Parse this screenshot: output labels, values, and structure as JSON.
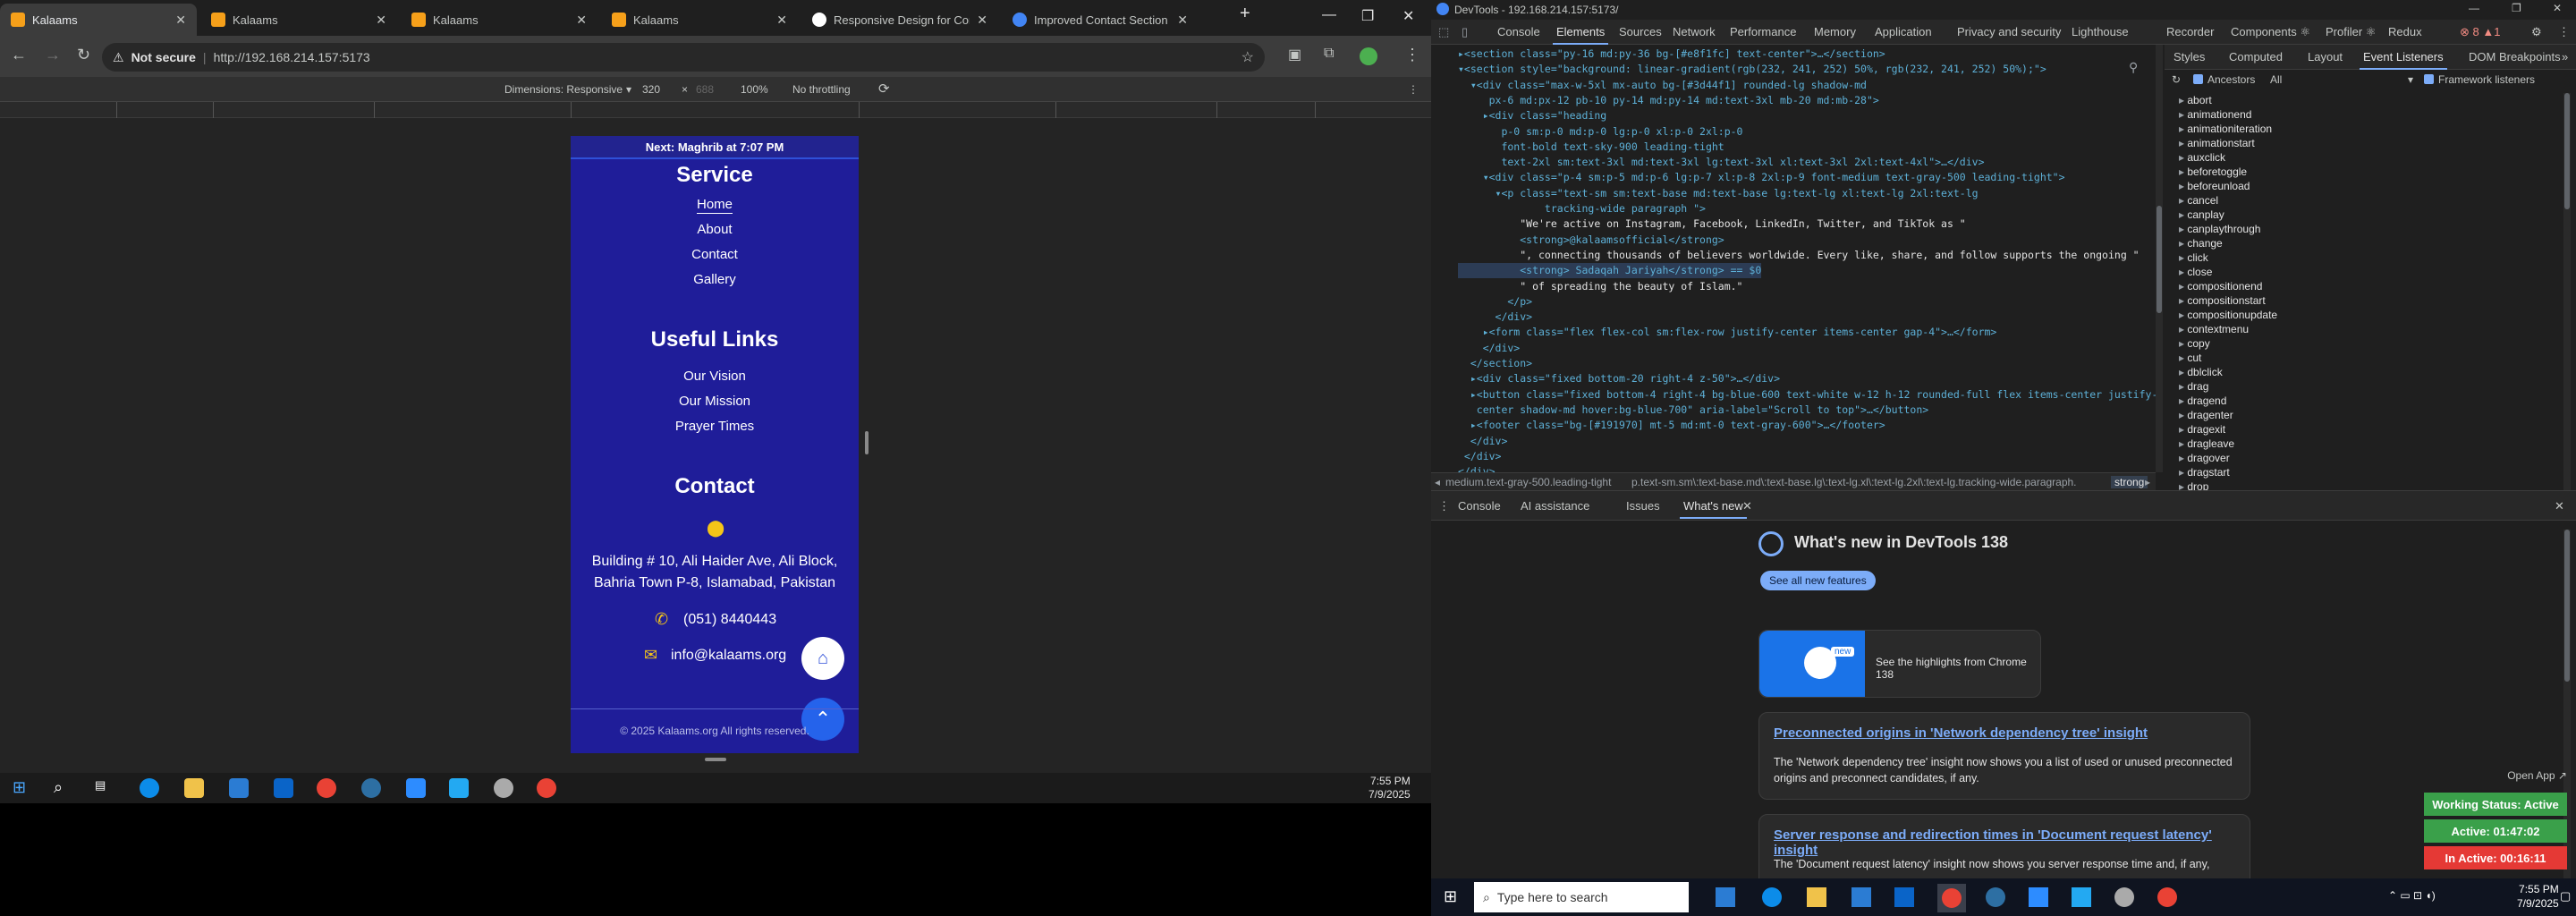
{
  "browser": {
    "tabs": [
      {
        "label": "Kalaams",
        "active": true
      },
      {
        "label": "Kalaams"
      },
      {
        "label": "Kalaams"
      },
      {
        "label": "Kalaams"
      },
      {
        "label": "Responsive Design for Conta"
      },
      {
        "label": "Improved Contact Section St"
      }
    ],
    "new_tab": "+",
    "security": "Not secure",
    "url": "http://192.168.214.157:5173",
    "window_controls": {
      "min": "—",
      "max": "❐",
      "close": "✕"
    }
  },
  "device_toolbar": {
    "dimensions_label": "Dimensions: Responsive",
    "width": "320",
    "times": "×",
    "height": "688",
    "zoom": "100%",
    "throttle": "No throttling"
  },
  "site": {
    "next_prayer": "Next: Maghrib at 7:07 PM",
    "service_heading": "Service",
    "service_links": [
      "Home",
      "About",
      "Contact",
      "Gallery"
    ],
    "useful_heading": "Useful Links",
    "useful_links": [
      "Our Vision",
      "Our Mission",
      "Prayer Times"
    ],
    "contact_heading": "Contact",
    "address": "Building # 10, Ali Haider Ave, Ali Block, Bahria Town P-8, Islamabad, Pakistan",
    "phone": "(051) 8440443",
    "email": "info@kalaams.org",
    "copyright": "© 2025 Kalaams.org All rights reserved."
  },
  "taskbar_left": {
    "time": "7:55 PM",
    "date": "7/9/2025"
  },
  "devtools": {
    "title": "DevTools - 192.168.214.157:5173/",
    "tabs": [
      "Console",
      "Elements",
      "Sources",
      "Network",
      "Performance",
      "Memory",
      "Application",
      "Privacy and security",
      "Lighthouse",
      "Recorder",
      "Components ⚛",
      "Profiler ⚛",
      "Redux"
    ],
    "active_tab": "Elements",
    "code_lines": [
      "▸<section class=\"py-16 md:py-36 bg-[#e8f1fc] text-center\">…</section>",
      "▾<section style=\"background: linear-gradient(rgb(232, 241, 252) 50%, rgb(232, 241, 252) 50%);\">",
      "  ▾<div class=\"max-w-5xl mx-auto bg-[#3d44f1] rounded-lg shadow-md",
      "     px-6 md:px-12 pb-10 py-14 md:py-14 md:text-3xl mb-20 md:mb-28\">",
      "    ▸<div class=\"heading",
      "       p-0 sm:p-0 md:p-0 lg:p-0 xl:p-0 2xl:p-0",
      "       font-bold text-sky-900 leading-tight",
      "       text-2xl sm:text-3xl md:text-3xl lg:text-3xl xl:text-3xl 2xl:text-4xl\">…</div>",
      "    ▾<div class=\"p-4 sm:p-5 md:p-6 lg:p-7 xl:p-8 2xl:p-9 font-medium text-gray-500 leading-tight\">",
      "      ▾<p class=\"text-sm sm:text-base md:text-base lg:text-lg xl:text-lg 2xl:text-lg",
      "              tracking-wide paragraph \">",
      "          \"We're active on Instagram, Facebook, LinkedIn, Twitter, and TikTok as \"",
      "          <strong>@kalaamsofficial</strong>",
      "          \", connecting thousands of believers worldwide. Every like, share, and follow supports the ongoing \"",
      "          <strong> Sadaqah Jariyah</strong> == $0",
      "          \" of spreading the beauty of Islam.\"",
      "        </p>",
      "      </div>",
      "    ▸<form class=\"flex flex-col sm:flex-row justify-center items-center gap-4\">…</form>",
      "    </div>",
      "  </section>",
      "  ▸<div class=\"fixed bottom-20 right-4 z-50\">…</div>",
      "  ▸<button class=\"fixed bottom-4 right-4 bg-blue-600 text-white w-12 h-12 rounded-full flex items-center justify-",
      "   center shadow-md hover:bg-blue-700\" aria-label=\"Scroll to top\">…</button>",
      "  ▸<footer class=\"bg-[#191970] mt-5 md:mt-0 text-gray-600\">…</footer>",
      "  </div>",
      " </div>",
      "</div>"
    ],
    "crumbs": [
      "medium.text-gray-500.leading-tight",
      "p.text-sm.sm\\:text-base.md\\:text-base.lg\\:text-lg.xl\\:text-lg.2xl\\:text-lg.tracking-wide.paragraph.",
      "strong"
    ],
    "side_tabs": [
      "Styles",
      "Computed",
      "Layout",
      "Event Listeners",
      "DOM Breakpoints"
    ],
    "active_side_tab": "Event Listeners",
    "ancestors": "Ancestors",
    "all": "All",
    "framework": "Framework listeners",
    "events": [
      "abort",
      "animationend",
      "animationiteration",
      "animationstart",
      "auxclick",
      "beforetoggle",
      "beforeunload",
      "cancel",
      "canplay",
      "canplaythrough",
      "change",
      "click",
      "close",
      "compositionend",
      "compositionstart",
      "compositionupdate",
      "contextmenu",
      "copy",
      "cut",
      "dblclick",
      "drag",
      "dragend",
      "dragenter",
      "dragexit",
      "dragleave",
      "dragover",
      "dragstart",
      "drop"
    ],
    "drawer_tabs": [
      "Console",
      "AI assistance",
      "Issues",
      "What's new"
    ],
    "active_drawer_tab": "What's new",
    "whats_new_title": "What's new in DevTools 138",
    "see_all": "See all new features",
    "highlights": "See the highlights from Chrome 138",
    "new_badge": "new",
    "card1_title": "Preconnected origins in 'Network dependency tree' insight",
    "card1_text": "The 'Network dependency tree' insight now shows you a list of used or unused preconnected origins and preconnect candidates, if any.",
    "card2_title": "Server response and redirection times in 'Document request latency' insight",
    "card2_text": "The 'Document request latency' insight now shows you server response time and, if any,",
    "open_app": "Open App ↗",
    "status_working": "Working Status: Active",
    "status_active": "Active: 01:47:02",
    "status_inactive": "In Active: 00:16:11"
  },
  "taskbar_right": {
    "search": "Type here to search",
    "time": "7:55 PM",
    "date": "7/9/2025"
  }
}
